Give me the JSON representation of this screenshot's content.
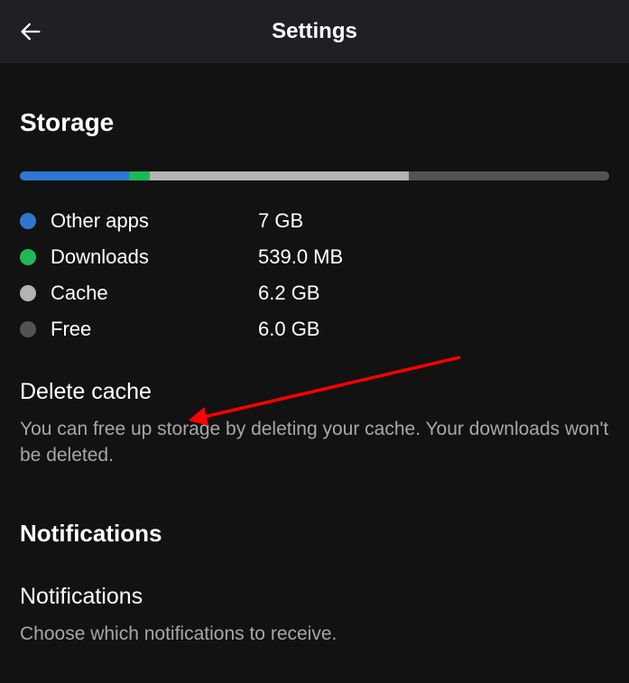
{
  "header": {
    "title": "Settings"
  },
  "storage": {
    "section_title": "Storage",
    "bar": [
      {
        "color": "#2e77d0",
        "percent": 18.5
      },
      {
        "color": "#1db954",
        "percent": 3.5
      },
      {
        "color": "#b3b3b3",
        "percent": 44
      },
      {
        "color": "#535353",
        "percent": 34
      }
    ],
    "legend": [
      {
        "color": "#2e77d0",
        "label": "Other apps",
        "value": "7 GB"
      },
      {
        "color": "#1db954",
        "label": "Downloads",
        "value": "539.0 MB"
      },
      {
        "color": "#b3b3b3",
        "label": "Cache",
        "value": "6.2 GB"
      },
      {
        "color": "#535353",
        "label": "Free",
        "value": "6.0 GB"
      }
    ],
    "delete_cache": {
      "title": "Delete cache",
      "desc": "You can free up storage by deleting your cache. Your downloads won't be deleted."
    }
  },
  "notifications": {
    "section_title": "Notifications",
    "item_title": "Notifications",
    "item_desc": "Choose which notifications to receive."
  }
}
